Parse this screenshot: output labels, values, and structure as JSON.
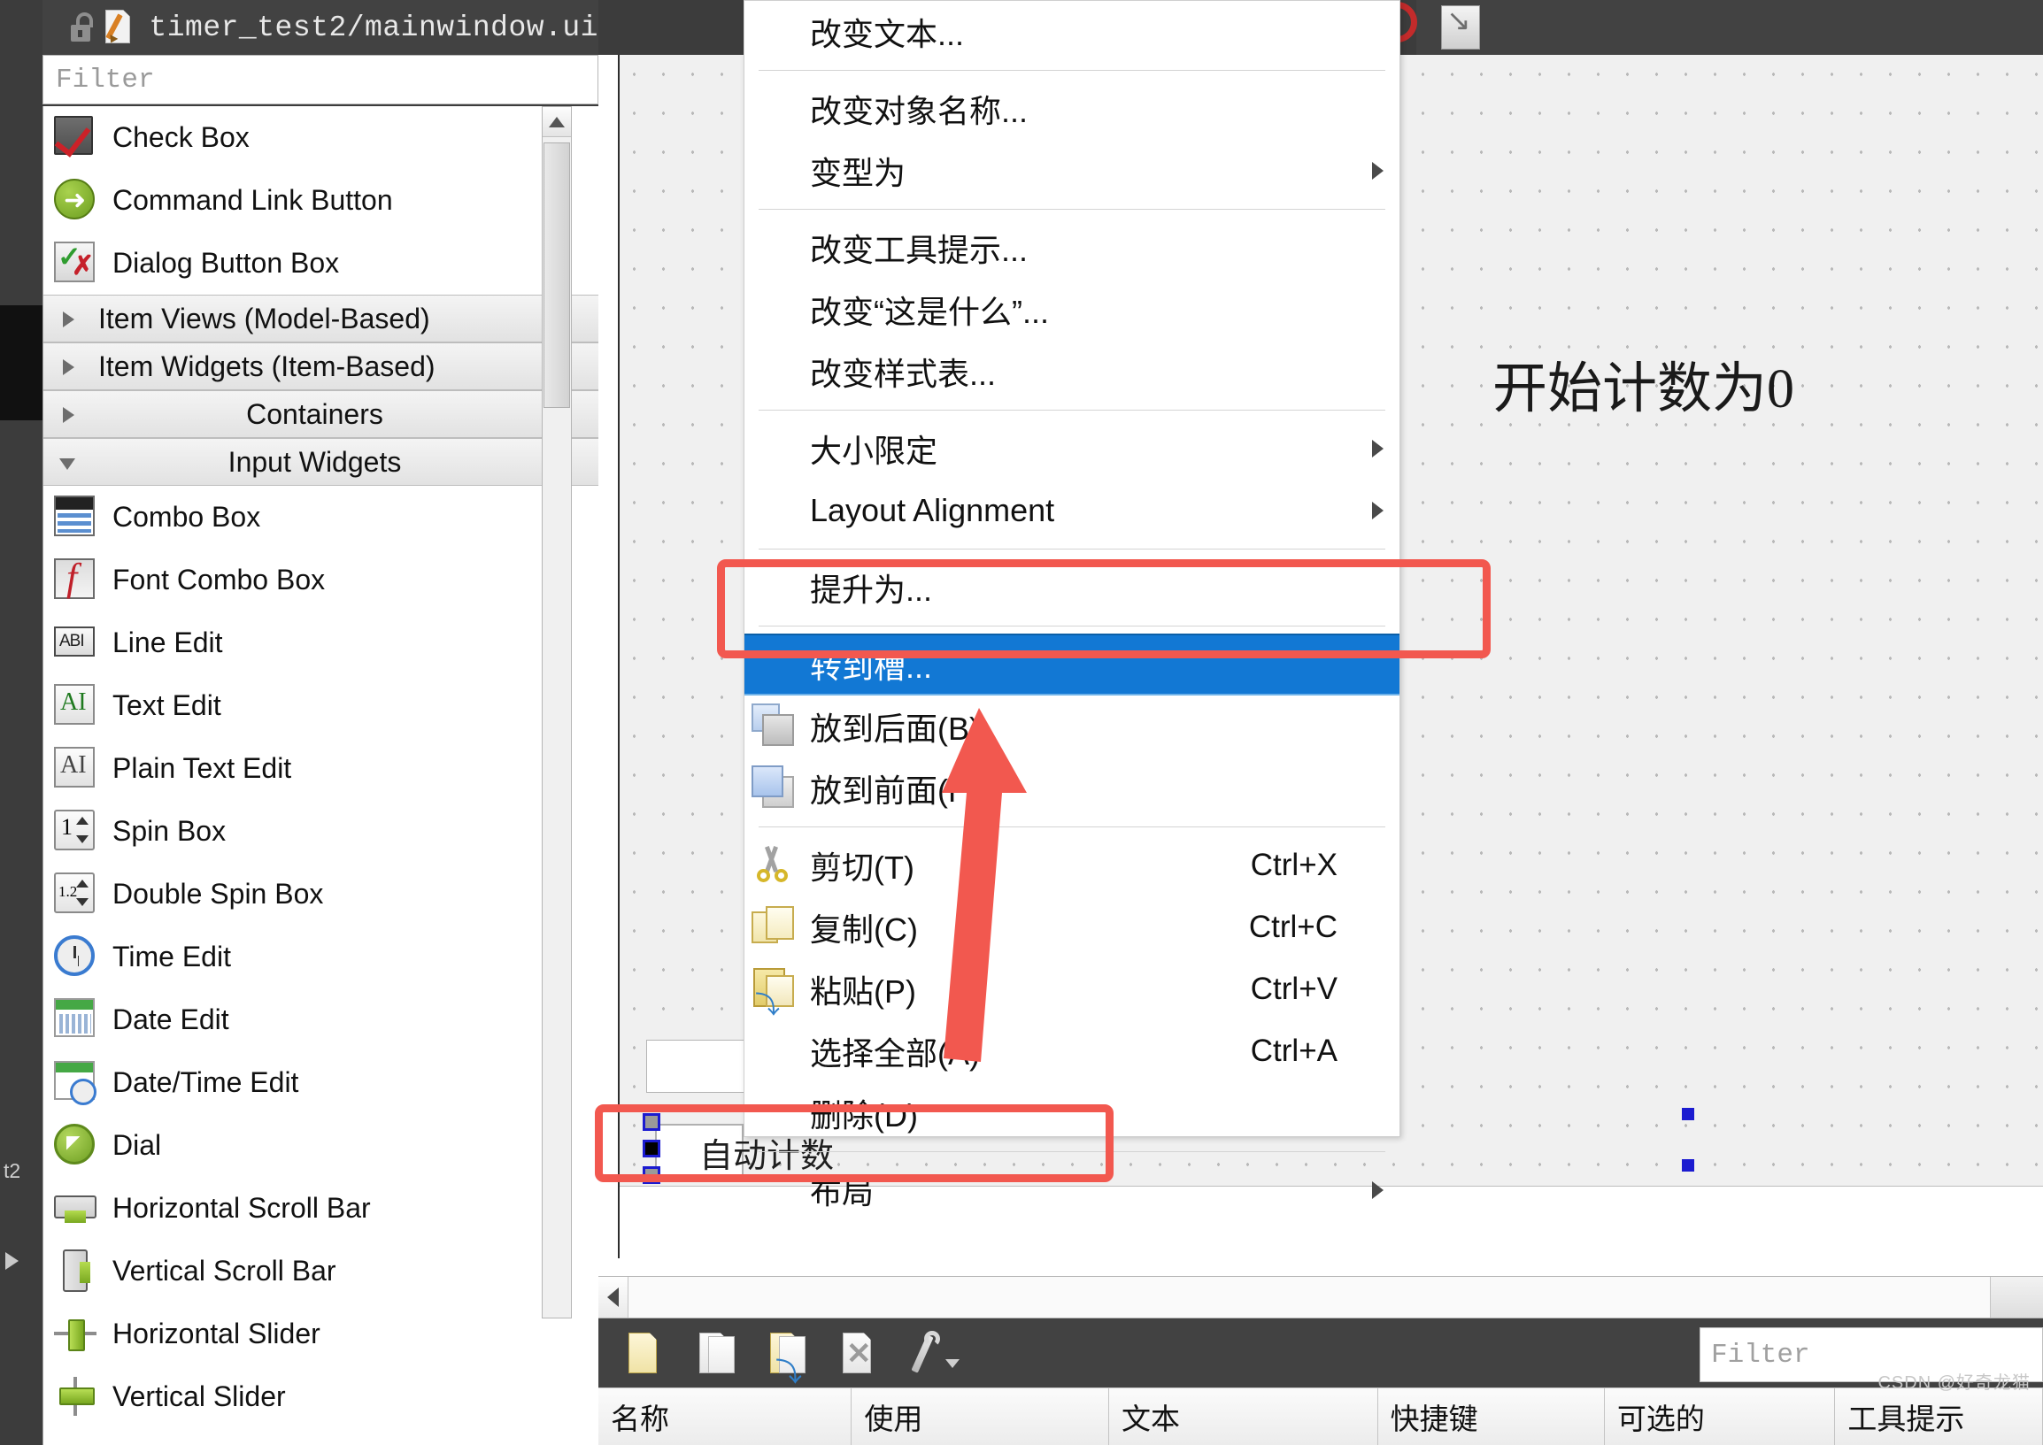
{
  "dock": {
    "title": "timer_test2/mainwindow.ui",
    "lock_icon": "lock-open-icon",
    "file_icon": "ui-file-icon",
    "float_button": "float-dock-button",
    "close_button": "close-dock-button"
  },
  "widget_filter": {
    "placeholder": "Filter",
    "value": ""
  },
  "widget_box": {
    "items": [
      {
        "label": "Check Box",
        "icon": "checkbox-icon",
        "type": "widget"
      },
      {
        "label": "Command Link Button",
        "icon": "command-link-icon",
        "type": "widget"
      },
      {
        "label": "Dialog Button Box",
        "icon": "dialog-button-box-icon",
        "type": "widget"
      },
      {
        "label": "Item Views (Model-Based)",
        "icon": "chevron-right-icon",
        "type": "group",
        "expanded": false,
        "align": "left"
      },
      {
        "label": "Item Widgets (Item-Based)",
        "icon": "chevron-right-icon",
        "type": "group",
        "expanded": false,
        "align": "left"
      },
      {
        "label": "Containers",
        "icon": "chevron-right-icon",
        "type": "group",
        "expanded": false,
        "align": "center"
      },
      {
        "label": "Input Widgets",
        "icon": "chevron-down-icon",
        "type": "group",
        "expanded": true,
        "align": "center"
      },
      {
        "label": "Combo Box",
        "icon": "combo-box-icon",
        "type": "widget"
      },
      {
        "label": "Font Combo Box",
        "icon": "font-combo-box-icon",
        "type": "widget"
      },
      {
        "label": "Line Edit",
        "icon": "line-edit-icon",
        "type": "widget"
      },
      {
        "label": "Text Edit",
        "icon": "text-edit-icon",
        "type": "widget"
      },
      {
        "label": "Plain Text Edit",
        "icon": "plain-text-edit-icon",
        "type": "widget"
      },
      {
        "label": "Spin Box",
        "icon": "spin-box-icon",
        "type": "widget"
      },
      {
        "label": "Double Spin Box",
        "icon": "double-spin-box-icon",
        "type": "widget"
      },
      {
        "label": "Time Edit",
        "icon": "time-edit-icon",
        "type": "widget"
      },
      {
        "label": "Date Edit",
        "icon": "date-edit-icon",
        "type": "widget"
      },
      {
        "label": "Date/Time Edit",
        "icon": "date-time-edit-icon",
        "type": "widget"
      },
      {
        "label": "Dial",
        "icon": "dial-icon",
        "type": "widget"
      },
      {
        "label": "Horizontal Scroll Bar",
        "icon": "horizontal-scroll-bar-icon",
        "type": "widget"
      },
      {
        "label": "Vertical Scroll Bar",
        "icon": "vertical-scroll-bar-icon",
        "type": "widget"
      },
      {
        "label": "Horizontal Slider",
        "icon": "horizontal-slider-icon",
        "type": "widget"
      },
      {
        "label": "Vertical Slider",
        "icon": "vertical-slider-icon",
        "type": "widget"
      }
    ]
  },
  "form_canvas": {
    "label_text": "开始计数为0",
    "button_text": "自动计数",
    "toolbar_icon": "resize-arrow-icon"
  },
  "context_menu": {
    "items": [
      {
        "label": "改变文本...",
        "icon": null,
        "shortcut": null,
        "submenu": false,
        "selected": false
      },
      {
        "sep": true
      },
      {
        "label": "改变对象名称...",
        "icon": null,
        "shortcut": null,
        "submenu": false,
        "selected": false
      },
      {
        "label": "变型为",
        "icon": null,
        "shortcut": null,
        "submenu": true,
        "selected": false
      },
      {
        "sep": true
      },
      {
        "label": "改变工具提示...",
        "icon": null,
        "shortcut": null,
        "submenu": false,
        "selected": false
      },
      {
        "label": "改变“这是什么”...",
        "icon": null,
        "shortcut": null,
        "submenu": false,
        "selected": false
      },
      {
        "label": "改变样式表...",
        "icon": null,
        "shortcut": null,
        "submenu": false,
        "selected": false
      },
      {
        "sep": true
      },
      {
        "label": "大小限定",
        "icon": null,
        "shortcut": null,
        "submenu": true,
        "selected": false
      },
      {
        "label": "Layout Alignment",
        "icon": null,
        "shortcut": null,
        "submenu": true,
        "selected": false
      },
      {
        "sep": true
      },
      {
        "label": "提升为...",
        "icon": null,
        "shortcut": null,
        "submenu": false,
        "selected": false
      },
      {
        "sep": true
      },
      {
        "label": "转到槽...",
        "icon": null,
        "shortcut": null,
        "submenu": false,
        "selected": true
      },
      {
        "label": "放到后面(B)",
        "icon": "send-to-back-icon",
        "shortcut": null,
        "submenu": false,
        "selected": false
      },
      {
        "label": "放到前面(F)",
        "icon": "bring-to-front-icon",
        "shortcut": null,
        "submenu": false,
        "selected": false
      },
      {
        "sep": true
      },
      {
        "label": "剪切(T)",
        "icon": "cut-icon",
        "shortcut": "Ctrl+X",
        "submenu": false,
        "selected": false
      },
      {
        "label": "复制(C)",
        "icon": "copy-icon",
        "shortcut": "Ctrl+C",
        "submenu": false,
        "selected": false
      },
      {
        "label": "粘贴(P)",
        "icon": "paste-icon",
        "shortcut": "Ctrl+V",
        "submenu": false,
        "selected": false
      },
      {
        "label": "选择全部(A)",
        "icon": null,
        "shortcut": "Ctrl+A",
        "submenu": false,
        "selected": false
      },
      {
        "label": "删除(D)",
        "icon": null,
        "shortcut": null,
        "submenu": false,
        "selected": false
      },
      {
        "sep": true
      },
      {
        "label": "布局",
        "icon": null,
        "shortcut": null,
        "submenu": true,
        "selected": false
      }
    ]
  },
  "action_editor": {
    "toolbar_icons": [
      "new-action-icon",
      "copy-action-icon",
      "paste-action-icon",
      "delete-action-icon",
      "edit-action-icon"
    ],
    "filter": {
      "placeholder": "Filter",
      "value": ""
    },
    "columns": [
      "名称",
      "使用",
      "文本",
      "快捷键",
      "可选的",
      "工具提示"
    ]
  },
  "rail": {
    "tab_label": "t2",
    "expand_icon": "chevron-right-icon"
  },
  "watermark": "CSDN @好奇龙猫",
  "colors": {
    "menu_highlight": "#1278d4",
    "annotation_red": "#f2584f",
    "dock_bar": "#424242",
    "canvas": "#f0f0f0",
    "selection_handle": "#1b1bd0"
  }
}
